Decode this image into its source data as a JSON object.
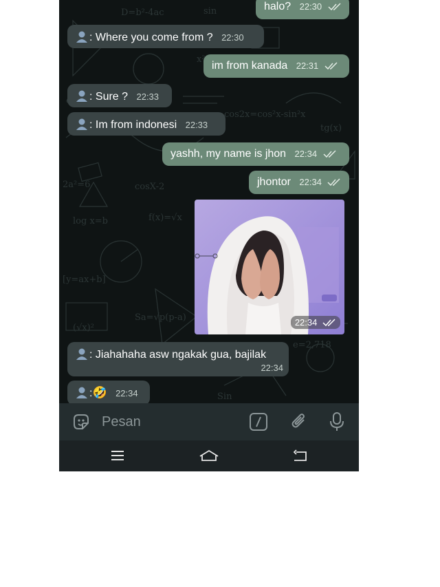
{
  "messages": [
    {
      "dir": "out",
      "text": "halo?",
      "time": "22:30",
      "status": "read"
    },
    {
      "dir": "in",
      "prefix": ": ",
      "text": "Where you come from ?",
      "time": "22:30"
    },
    {
      "dir": "out",
      "text": "im from kanada",
      "time": "22:31",
      "status": "read"
    },
    {
      "dir": "in",
      "prefix": ": ",
      "text": "Sure ?",
      "time": "22:33"
    },
    {
      "dir": "in",
      "prefix": ": ",
      "text": "Im from indonesi",
      "time": "22:33"
    },
    {
      "dir": "out",
      "text": "yashh, my name is jhon",
      "time": "22:34",
      "status": "read"
    },
    {
      "dir": "out",
      "text": "jhontor",
      "time": "22:34",
      "status": "read"
    },
    {
      "dir": "out",
      "type": "photo",
      "time": "22:34",
      "status": "read"
    },
    {
      "dir": "in",
      "prefix": ": ",
      "text": "Jiahahaha asw ngakak gua, bajilak",
      "time": "22:34"
    },
    {
      "dir": "in",
      "prefix": ":",
      "emoji": "🤣",
      "time": "22:34"
    }
  ],
  "composer": {
    "placeholder": "Pesan"
  },
  "icons": {
    "sticker": "sticker-icon",
    "command": "slash-command-icon",
    "attach": "paperclip-icon",
    "mic": "microphone-icon",
    "nav_menu": "menu-icon",
    "nav_home": "home-icon",
    "nav_back": "back-icon"
  },
  "colors": {
    "incoming_bubble": "#3a4445",
    "outgoing_bubble": "#6c8a78",
    "background": "#0f1414"
  }
}
